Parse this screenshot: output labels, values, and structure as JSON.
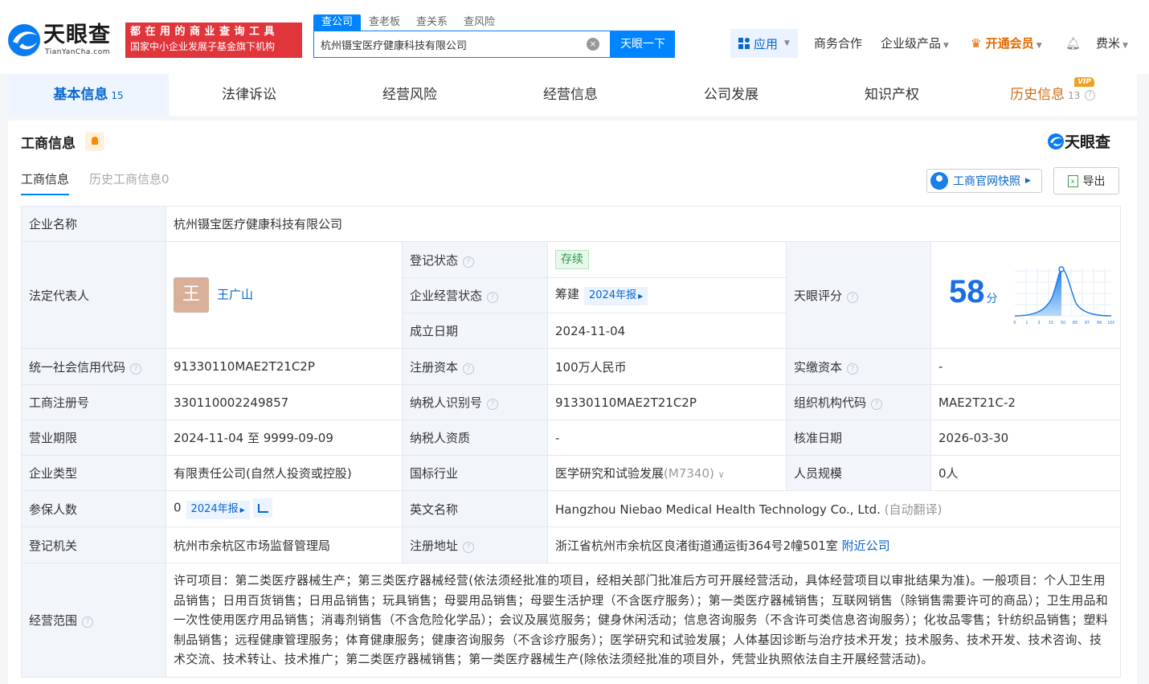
{
  "header": {
    "logo_text": "天眼查",
    "logo_sub": "TianYanCha.com",
    "slogan_line1": "都在用的商业查询工具",
    "slogan_line2": "国家中小企业发展子基金旗下机构",
    "search_tabs": [
      "查公司",
      "查老板",
      "查关系",
      "查风险"
    ],
    "search_value": "杭州镊宝医疗健康科技有限公司",
    "search_button": "天眼一下",
    "app_label": "应用",
    "business": "商务合作",
    "enterprise": "企业级产品",
    "vip": "开通会员",
    "user": "费米"
  },
  "main_tabs": [
    {
      "label": "基本信息",
      "count": "15"
    },
    {
      "label": "法律诉讼"
    },
    {
      "label": "经营风险"
    },
    {
      "label": "经营信息"
    },
    {
      "label": "公司发展"
    },
    {
      "label": "知识产权"
    },
    {
      "label": "历史信息",
      "count": "13",
      "badge": "VIP"
    }
  ],
  "section": {
    "title": "工商信息",
    "brand": "天眼查",
    "subtab_active": "工商信息",
    "subtab_history": "历史工商信息0",
    "snapshot_btn": "工商官网快照",
    "export_btn": "导出"
  },
  "info": {
    "company_name_k": "企业名称",
    "company_name_v": "杭州镊宝医疗健康科技有限公司",
    "legal_rep_k": "法定代表人",
    "legal_rep_avatar": "王",
    "legal_rep_v": "王广山",
    "reg_status_k": "登记状态",
    "reg_status_v": "存续",
    "biz_status_k": "企业经营状态",
    "biz_status_v": "筹建",
    "biz_status_tag": "2024年报",
    "found_k": "成立日期",
    "found_v": "2024-11-04",
    "score_k": "天眼评分",
    "score_v": "58",
    "score_unit": "分",
    "score_ticks": [
      "0",
      "1",
      "3",
      "15",
      "50",
      "85",
      "97",
      "99",
      "100"
    ],
    "credit_k": "统一社会信用代码",
    "credit_v": "91330110MAE2T21C2P",
    "capital_k": "注册资本",
    "capital_v": "100万人民币",
    "paid_k": "实缴资本",
    "paid_v": "-",
    "regno_k": "工商注册号",
    "regno_v": "330110002249857",
    "taxid_k": "纳税人识别号",
    "taxid_v": "91330110MAE2T21C2P",
    "orgcode_k": "组织机构代码",
    "orgcode_v": "MAE2T21C-2",
    "term_k": "营业期限",
    "term_v": "2024-11-04 至 9999-09-09",
    "taxq_k": "纳税人资质",
    "taxq_v": "-",
    "approve_k": "核准日期",
    "approve_v": "2026-03-30",
    "type_k": "企业类型",
    "type_v": "有限责任公司(自然人投资或控股)",
    "industry_k": "国标行业",
    "industry_v": "医学研究和试验发展",
    "industry_code": "(M7340)",
    "staff_k": "人员规模",
    "staff_v": "0人",
    "insured_k": "参保人数",
    "insured_v": "0",
    "insured_tag": "2024年报",
    "en_k": "英文名称",
    "en_v": "Hangzhou Niebao Medical Health Technology Co., Ltd.",
    "en_note": "(自动翻译)",
    "authority_k": "登记机关",
    "authority_v": "杭州市余杭区市场监督管理局",
    "addr_k": "注册地址",
    "addr_v": "浙江省杭州市余杭区良渚街道通运街364号2幢501室",
    "addr_link": "附近公司",
    "scope_k": "经营范围",
    "scope_v": "许可项目：第二类医疗器械生产；第三类医疗器械经营(依法须经批准的项目，经相关部门批准后方可开展经营活动，具体经营项目以审批结果为准)。一般项目：个人卫生用品销售；日用百货销售；日用品销售；玩具销售；母婴用品销售；母婴生活护理（不含医疗服务）；第一类医疗器械销售；互联网销售（除销售需要许可的商品）；卫生用品和一次性使用医疗用品销售；消毒剂销售（不含危险化学品）；会议及展览服务；健身休闲活动；信息咨询服务（不含许可类信息咨询服务）；化妆品零售；针纺织品销售；塑料制品销售；远程健康管理服务；体育健康服务；健康咨询服务（不含诊疗服务）；医学研究和试验发展；人体基因诊断与治疗技术开发；技术服务、技术开发、技术咨询、技术交流、技术转让、技术推广；第二类医疗器械销售；第一类医疗器械生产(除依法须经批准的项目外，凭营业执照依法自主开展经营活动)。"
  },
  "colors": {
    "brand_blue": "#0084ff",
    "link": "#0a66cc",
    "slogan_red": "#e0353b",
    "vip_orange": "#e06a00"
  }
}
